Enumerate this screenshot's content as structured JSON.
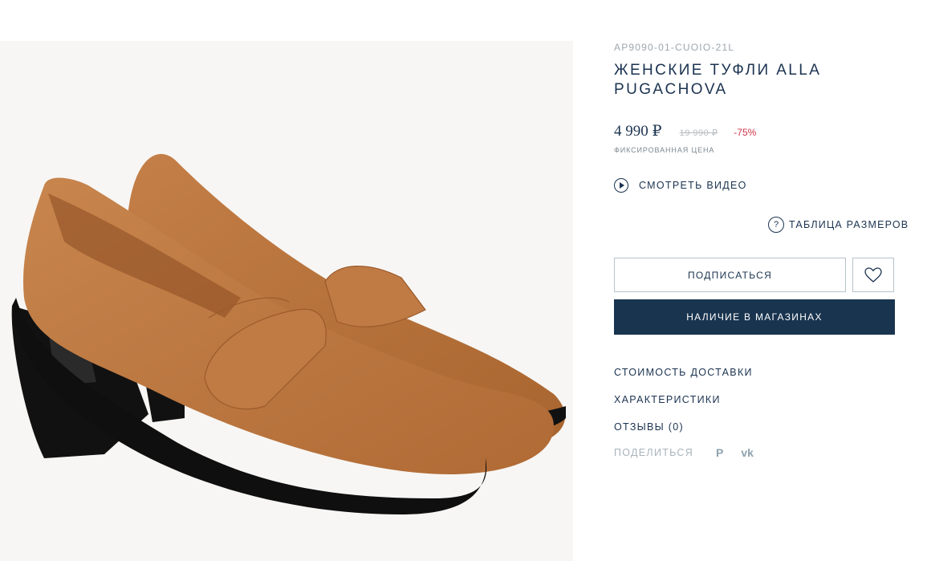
{
  "product": {
    "sku": "AP9090-01-CUOIO-21L",
    "title": "ЖЕНСКИЕ ТУФЛИ ALLA PUGACHOVA",
    "price": "4 990 ₽",
    "old_price": "19 990 ₽",
    "discount": "-75%",
    "price_note": "ФИКСИРОВАННАЯ ЦЕНА"
  },
  "actions": {
    "video_label": "СМОТРЕТЬ ВИДЕО",
    "size_table_label": "ТАБЛИЦА РАЗМЕРОВ",
    "size_icon_glyph": "?",
    "subscribe_label": "ПОДПИСАТЬСЯ",
    "stores_label": "НАЛИЧИЕ В МАГАЗИНАХ"
  },
  "links": {
    "delivery": "СТОИМОСТЬ ДОСТАВКИ",
    "characteristics": "ХАРАКТЕРИСТИКИ",
    "reviews": "ОТЗЫВЫ (0)"
  },
  "share": {
    "label": "ПОДЕЛИТЬСЯ",
    "pinterest_glyph": "P",
    "vk_glyph": "vk"
  },
  "colors": {
    "navy": "#19344f",
    "sale_red": "#d0344a",
    "suede": "#b8733f"
  }
}
